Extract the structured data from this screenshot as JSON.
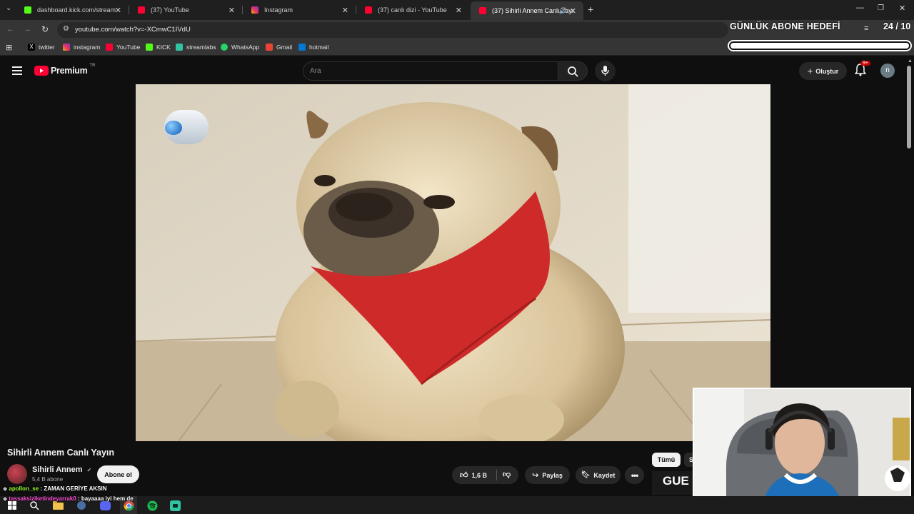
{
  "browser": {
    "tabs": [
      {
        "title": "dashboard.kick.com/stream",
        "color": "#53fc18"
      },
      {
        "title": "(37) YouTube",
        "color": "#ff0033"
      },
      {
        "title": "Instagram",
        "color": "#e1306c"
      },
      {
        "title": "(37) canlı dizi - YouTube",
        "color": "#ff0033"
      },
      {
        "title": "(37) Sihirli Annem Canlı Yayı",
        "color": "#ff0033"
      }
    ],
    "url": "youtube.com/watch?v=-XCmwC1IVdU",
    "bookmarks": [
      {
        "label": "twitter",
        "icon": "x-icon",
        "color": "#000000"
      },
      {
        "label": "instagram",
        "icon": "instagram-icon",
        "color": "#e1306c"
      },
      {
        "label": "YouTube",
        "icon": "youtube-icon",
        "color": "#ff0033"
      },
      {
        "label": "KICK",
        "icon": "kick-icon",
        "color": "#53fc18"
      },
      {
        "label": "streamlabs",
        "icon": "streamlabs-icon",
        "color": "#31c3a2"
      },
      {
        "label": "WhatsApp",
        "icon": "whatsapp-icon",
        "color": "#25d366"
      },
      {
        "label": "Gmail",
        "icon": "gmail-icon",
        "color": "#ea4335"
      },
      {
        "label": "hotmail",
        "icon": "hotmail-icon",
        "color": "#0078d4"
      }
    ]
  },
  "youtube": {
    "logo_text": "Premium",
    "logo_region": "TR",
    "search_placeholder": "Ara",
    "create_label": "Oluştur",
    "notif_count": "9+",
    "avatar_letter": "n",
    "video_title": "Sihirli Annem Canlı Yayın",
    "channel_name": "Sihirli Annem",
    "subscribers": "5,4 B abone",
    "subscribe_label": "Abone ol",
    "like_count": "1,6 B",
    "share_label": "Paylaş",
    "save_label": "Kaydet",
    "chip_all": "Tümü",
    "chip_partial": "S",
    "thumb_text": "GUE"
  },
  "overlay": {
    "goal_label": "GÜNLÜK ABONE HEDEFİ",
    "goal_count": "24 / 10",
    "goal_progress": 1.0,
    "chat": [
      {
        "user": "apollon_se",
        "msg": "ZAMAN GERİYE AKSIN",
        "user_color": "#9bff2e"
      },
      {
        "user": "tassaksiziketindeyarrak0",
        "msg": "bayaaaa iyi hem de",
        "user_color": "#ff4fd8"
      }
    ]
  },
  "colors": {
    "yt_red": "#ff0033",
    "accent": "#3ea6ff"
  }
}
